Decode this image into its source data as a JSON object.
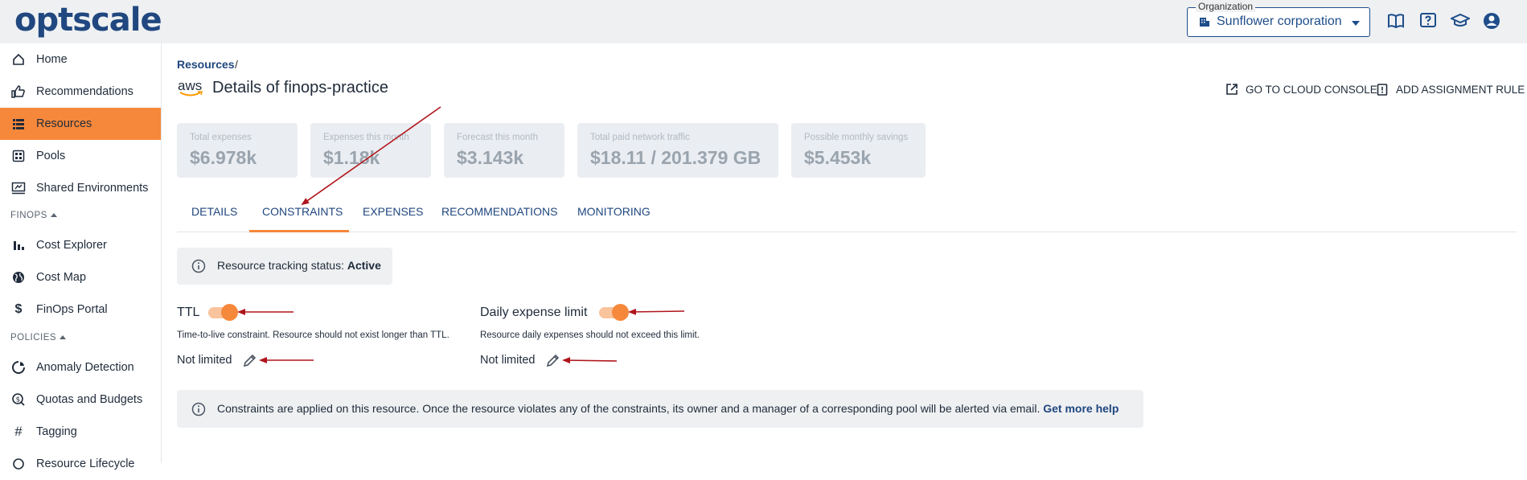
{
  "app": {
    "logo_text": "optscale"
  },
  "header": {
    "org_label": "Organization",
    "org_value": "Sunflower corporation",
    "icons": [
      "documentation-icon",
      "help-icon",
      "training-icon",
      "profile-icon"
    ]
  },
  "sidebar": {
    "items": [
      {
        "label": "Home",
        "icon": "home-icon"
      },
      {
        "label": "Recommendations",
        "icon": "thumbs-up-icon"
      },
      {
        "label": "Resources",
        "icon": "list-icon",
        "active": true
      },
      {
        "label": "Pools",
        "icon": "pools-icon"
      },
      {
        "label": "Shared Environments",
        "icon": "environment-icon"
      }
    ],
    "section_finops": "FINOPS",
    "finops_items": [
      {
        "label": "Cost Explorer",
        "icon": "bar-chart-icon"
      },
      {
        "label": "Cost Map",
        "icon": "globe-icon"
      },
      {
        "label": "FinOps Portal",
        "icon": "dollar-icon"
      }
    ],
    "section_policies": "POLICIES",
    "policies_items": [
      {
        "label": "Anomaly Detection",
        "icon": "anomaly-icon"
      },
      {
        "label": "Quotas and Budgets",
        "icon": "budget-icon"
      },
      {
        "label": "Tagging",
        "icon": "hashtag-icon"
      },
      {
        "label": "Resource Lifecycle",
        "icon": "lifecycle-icon"
      }
    ]
  },
  "breadcrumb": {
    "root": "Resources",
    "sep": "/"
  },
  "page": {
    "provider": "aws",
    "title": "Details of finops-practice",
    "actions": {
      "console": "GO TO CLOUD CONSOLE",
      "assignment": "ADD ASSIGNMENT RULE"
    }
  },
  "summary_cards": [
    {
      "label": "Total expenses",
      "value": "$6.978k"
    },
    {
      "label": "Expenses this month",
      "value": "$1.18k"
    },
    {
      "label": "Forecast this month",
      "value": "$3.143k"
    },
    {
      "label": "Total paid network traffic",
      "value": "$18.11 / 201.379 GB"
    },
    {
      "label": "Possible monthly savings",
      "value": "$5.453k"
    }
  ],
  "tabs": [
    {
      "label": "DETAILS"
    },
    {
      "label": "CONSTRAINTS",
      "active": true
    },
    {
      "label": "EXPENSES"
    },
    {
      "label": "RECOMMENDATIONS"
    },
    {
      "label": "MONITORING"
    }
  ],
  "tracking": {
    "label": "Resource tracking status: ",
    "value": "Active"
  },
  "constraints": {
    "ttl": {
      "title": "TTL",
      "description": "Time-to-live constraint. Resource should not exist longer than TTL.",
      "value": "Not limited",
      "enabled": true
    },
    "daily": {
      "title": "Daily expense limit",
      "description": "Resource daily expenses should not exceed this limit.",
      "value": "Not limited",
      "enabled": true
    }
  },
  "note": {
    "text": "Constraints are applied on this resource. Once the resource violates any of the constraints, its owner and a manager of a corresponding pool will be alerted via email. ",
    "link": "Get more help"
  },
  "colors": {
    "accent": "#f6883b",
    "primary": "#20477f",
    "annotation": "#b0151c"
  }
}
